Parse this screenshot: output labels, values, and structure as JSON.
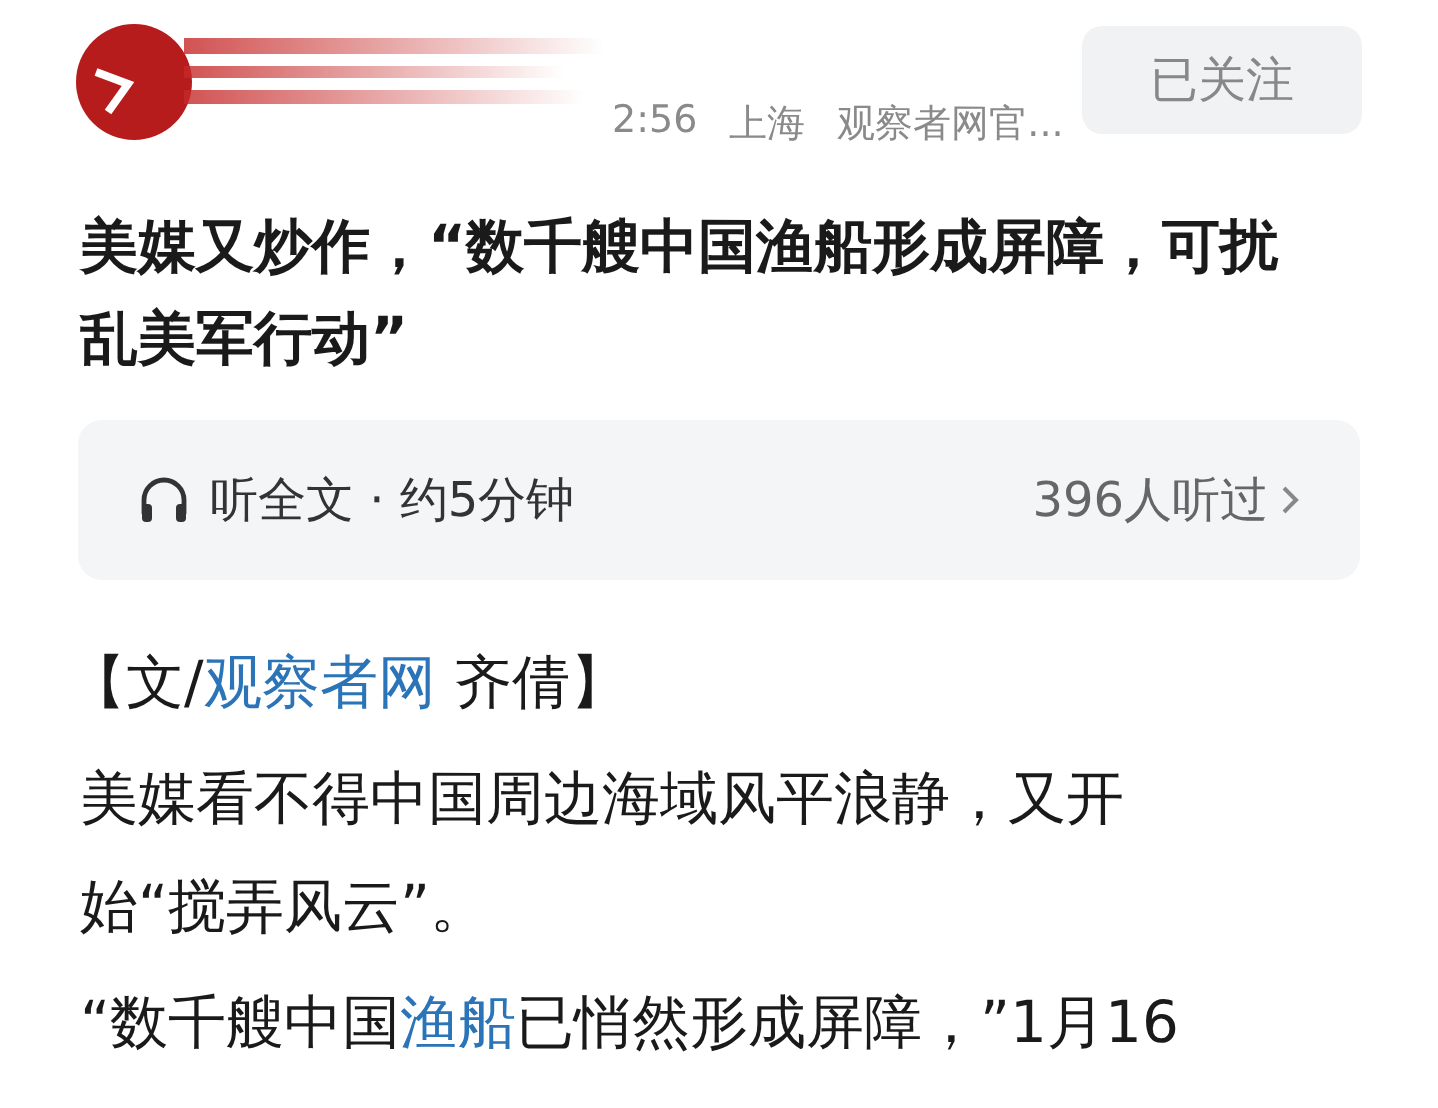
{
  "header": {
    "meta": [
      {
        "text": "2:56"
      },
      {
        "text": "上海"
      },
      {
        "text": "观察者网官..."
      }
    ],
    "follow_button": {
      "label": "已关注",
      "selected": true
    }
  },
  "title": "美媒又炒作，“数千艘中国渔船形成屏障，可扰乱美军行动”",
  "listen_bar": {
    "label": "听全文 · 约5分钟",
    "count": "396人听过"
  },
  "paragraphs": [
    {
      "segments": [
        {
          "text": "【文/",
          "link": false
        },
        {
          "text": "观察者网",
          "link": true
        },
        {
          "text": " 齐倩】",
          "link": false
        }
      ]
    },
    {
      "segments": [
        {
          "text": "美媒看不得中国周边海域风平浪静，又开始“搅弄风云”。",
          "link": false
        }
      ]
    },
    {
      "segments": [
        {
          "text": "“数千艘中国",
          "link": false
        },
        {
          "text": "渔船",
          "link": true
        },
        {
          "text": "已悄然形成屏障，”1月16",
          "link": false
        }
      ]
    }
  ]
}
